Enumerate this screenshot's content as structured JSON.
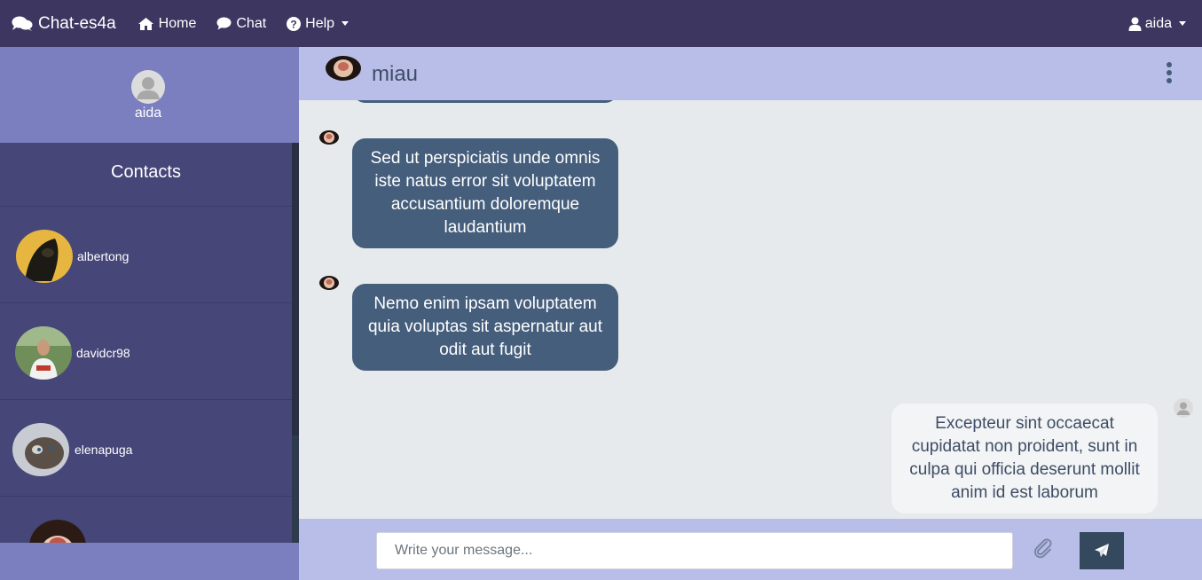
{
  "navbar": {
    "brand": "Chat-es4a",
    "links": [
      {
        "label": "Home",
        "icon": "home-icon"
      },
      {
        "label": "Chat",
        "icon": "comment-icon"
      },
      {
        "label": "Help",
        "icon": "question-circle-icon"
      }
    ],
    "user": "aida"
  },
  "sidebar": {
    "profile_name": "aida",
    "contacts_title": "Contacts",
    "contacts": [
      {
        "name": "albertong"
      },
      {
        "name": "davidcr98"
      },
      {
        "name": "elenapuga"
      },
      {
        "name": ""
      }
    ]
  },
  "chat": {
    "contact_name": "miau",
    "messages": [
      {
        "direction": "in",
        "text": "Sed ut perspiciatis unde omnis iste natus error sit voluptatem accusantium doloremque laudantium"
      },
      {
        "direction": "in",
        "text": "Nemo enim ipsam voluptatem quia voluptas sit aspernatur aut odit aut fugit"
      },
      {
        "direction": "out",
        "text": "Excepteur sint occaecat cupidatat non proident, sunt in culpa qui officia deserunt mollit anim id est laborum"
      }
    ],
    "input_placeholder": "Write your message..."
  },
  "colors": {
    "navbar": "#3d3660",
    "sidebar": "#7b7fbf",
    "contacts_bg": "#464679",
    "header": "#b9bee8",
    "bubble_in": "#455e7c",
    "bubble_out": "#f3f4f5",
    "send_button": "#34495e"
  }
}
